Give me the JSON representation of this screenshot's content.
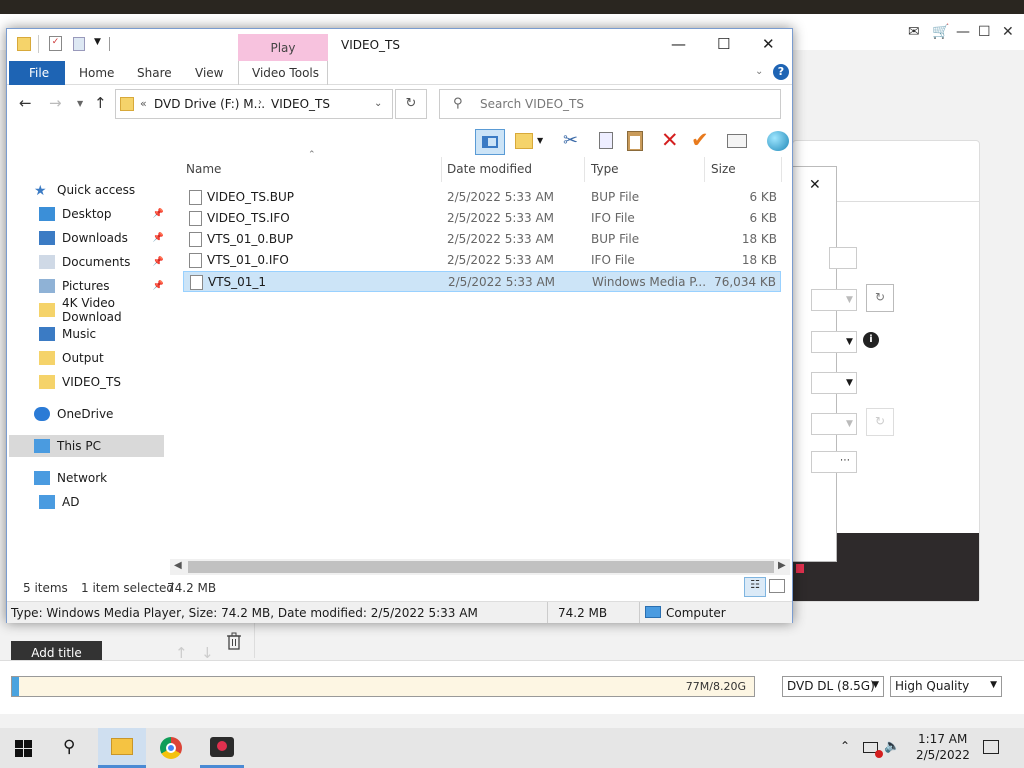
{
  "explorer": {
    "title": "VIDEO_TS",
    "contextual_tab": "Play",
    "ribbon_tabs": [
      "File",
      "Home",
      "Share",
      "View",
      "Video Tools"
    ],
    "address_prefix": "«",
    "address_path": [
      "DVD Drive (F:) M...",
      "VIDEO_TS"
    ],
    "search_placeholder": "Search VIDEO_TS",
    "nav": [
      {
        "label": "Quick access",
        "icon": "star-icon",
        "pinned": false
      },
      {
        "label": "Desktop",
        "icon": "desktop-folder-icon",
        "pinned": true
      },
      {
        "label": "Downloads",
        "icon": "download-arrow-icon",
        "pinned": true
      },
      {
        "label": "Documents",
        "icon": "documents-icon",
        "pinned": true
      },
      {
        "label": "Pictures",
        "icon": "pictures-icon",
        "pinned": true
      },
      {
        "label": "4K Video Download",
        "icon": "folder-icon",
        "pinned": false
      },
      {
        "label": "Music",
        "icon": "music-note-icon",
        "pinned": false
      },
      {
        "label": "Output",
        "icon": "folder-icon",
        "pinned": false
      },
      {
        "label": "VIDEO_TS",
        "icon": "folder-icon",
        "pinned": false
      },
      {
        "label": "OneDrive",
        "icon": "cloud-icon",
        "pinned": false
      },
      {
        "label": "This PC",
        "icon": "computer-icon",
        "pinned": false
      },
      {
        "label": "Network",
        "icon": "network-icon",
        "pinned": false
      },
      {
        "label": "AD",
        "icon": "computer-icon",
        "pinned": false
      }
    ],
    "columns": [
      "Name",
      "Date modified",
      "Type",
      "Size"
    ],
    "files": [
      {
        "name": "VIDEO_TS.BUP",
        "date": "2/5/2022 5:33 AM",
        "type": "BUP File",
        "size": "6 KB"
      },
      {
        "name": "VIDEO_TS.IFO",
        "date": "2/5/2022 5:33 AM",
        "type": "IFO File",
        "size": "6 KB"
      },
      {
        "name": "VTS_01_0.BUP",
        "date": "2/5/2022 5:33 AM",
        "type": "BUP File",
        "size": "18 KB"
      },
      {
        "name": "VTS_01_0.IFO",
        "date": "2/5/2022 5:33 AM",
        "type": "IFO File",
        "size": "18 KB"
      },
      {
        "name": "VTS_01_1",
        "date": "2/5/2022 5:33 AM",
        "type": "Windows Media P...",
        "size": "76,034 KB"
      }
    ],
    "status": {
      "items": "5 items",
      "selected": "1 item selected",
      "selected_size": "74.2 MB"
    },
    "details": {
      "text": "Type: Windows Media Player, Size: 74.2 MB, Date modified: 2/5/2022 5:33 AM",
      "size": "74.2 MB",
      "location": "Computer"
    }
  },
  "background_app": {
    "add_title_label": "Add title",
    "progress_text": "77M/8.20G",
    "progress_fraction": 0.01,
    "disc_select": "DVD DL (8.5G)",
    "quality_select": "High Quality"
  },
  "taskbar": {
    "time": "1:17 AM",
    "date": "2/5/2022"
  },
  "colors": {
    "accent": "#1e64b4",
    "selection": "#cce4f7",
    "play_tab": "#f7c2de"
  }
}
